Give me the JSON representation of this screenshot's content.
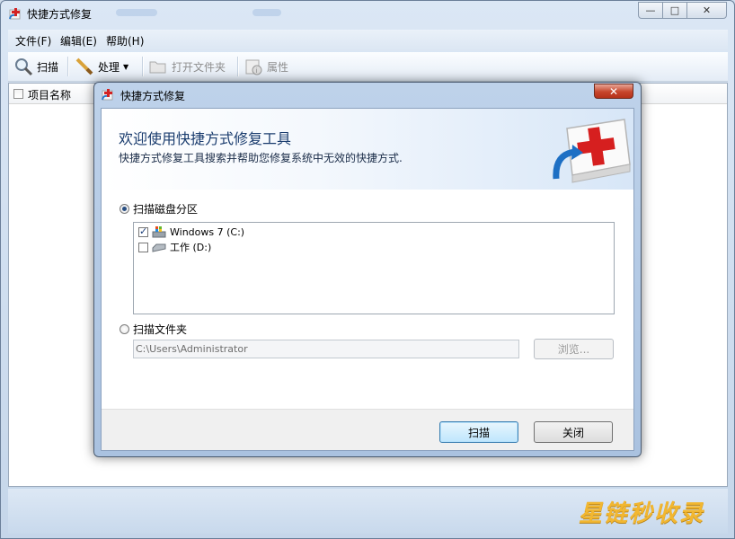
{
  "window": {
    "title": "快捷方式修复",
    "caption_minimize": "—",
    "caption_maximize": "□",
    "caption_close": "✕"
  },
  "menu": {
    "items": [
      {
        "label": "文件(F)"
      },
      {
        "label": "编辑(E)"
      },
      {
        "label": "帮助(H)"
      }
    ]
  },
  "toolbar": {
    "scan_label": "扫描",
    "process_label": "处理",
    "open_folder_label": "打开文件夹",
    "properties_label": "属性"
  },
  "list": {
    "header_item_name": "项目名称"
  },
  "dialog": {
    "title": "快捷方式修复",
    "close_glyph": "✕",
    "banner_title": "欢迎使用快捷方式修复工具",
    "banner_desc": "快捷方式修复工具搜索并帮助您修复系统中无效的快捷方式.",
    "scan_disk_label": "扫描磁盘分区",
    "scan_disk_selected": true,
    "drives": [
      {
        "label": "Windows 7 (C:)",
        "checked": true
      },
      {
        "label": "工作 (D:)",
        "checked": false
      }
    ],
    "scan_folder_label": "扫描文件夹",
    "scan_folder_selected": false,
    "folder_path": "C:\\Users\\Administrator",
    "browse_label": "浏览...",
    "scan_button": "扫描",
    "close_button": "关闭"
  },
  "watermark": "星链秒收录",
  "colors": {
    "accent": "#2a4f82",
    "title_text": "#1a3c6e",
    "close_red": "#c7462c",
    "watermark": "#f2b731"
  },
  "icons": {
    "app": "shortcut-repair-icon",
    "scan": "magnifier-icon",
    "process": "wand-icon",
    "open_folder": "folder-icon",
    "properties": "properties-icon",
    "banner": "first-aid-kit-icon",
    "drive_c": "system-drive-icon",
    "drive_d": "hard-drive-icon"
  }
}
